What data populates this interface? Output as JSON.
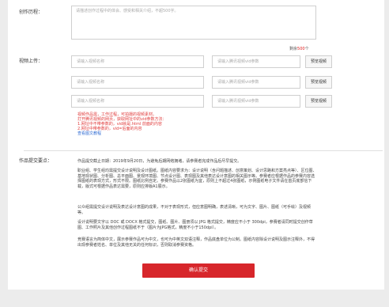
{
  "form": {
    "creation_label": "创作历程：",
    "creation_placeholder": "请描述创作过程中的体会、感受和相关介绍，不超500字。",
    "counter_prefix": "剩余",
    "counter_value": "500",
    "counter_suffix": "个",
    "video_label": "视频上传：",
    "video_rows": [
      {
        "name_placeholder": "请输入视频名称",
        "vid_placeholder": "请输入腾讯视频vid参数",
        "preview": "预览视频"
      },
      {
        "name_placeholder": "请输入视频名称",
        "vid_placeholder": "请输入腾讯视频vid参数",
        "preview": "预览视频"
      },
      {
        "name_placeholder": "请输入视频名称",
        "vid_placeholder": "请输入腾讯视频vid参数",
        "preview": "预览视频"
      }
    ],
    "notes": [
      "视频作品需，工作过程，可拍摄的视频素材。",
      "打开腾讯视频的网页，获取网址中的vid参数方法：",
      "1.网址中不带参数的，vid就是.html 前面的内容",
      "2.网址中带参数的，vid=后面的内容"
    ],
    "notes_link": "查看图文教程",
    "submit_rules_label": "作品提交要点：",
    "rules": [
      "作品提交截止日期：2019年9月20日，为避免后期网络拥堵，请参赛者完成作品后尽早提交。",
      "职业组、学生组均需提交设计说明及设计图纸。图纸内容要求为：设计说明（含问题描述、创意策划、设计思路和方案亮点等）、区位图、基地现状图、分析图、总平面图、景观环境图、节点设计图、表现图及其他表达设计意图的相关图示等。参赛者应根据作品的参赛内容选择图纸的表现方式，形式不限。图纸比例自定。参赛作品以2张图纸为宜，原则上不超过4张图纸，示例图纸电子文件请在首页底部信下载，版式可根据作品表达需要，原则应排版A1展示。",
      "公众组需提交设计说明及表达设计意图的成果，不对于表现形式，但应意图明确，表述清晰，可为文字、图片、图纸（可手绘）及视频等。",
      "设计说明要文字以 DOC 或 DOCX 格式提交，图纸、图片、图册须以 JPG 格式提交，精度应不小于 300dpi，参赛者请同时提交创作草图、工作照片及其他创作过程图纸不于（图片为JPG格式，精度不小于150dpi）。",
      "竞赛语言为简体中文，展示参赛作品可为中文，也可为中英文双语注释，作品底盘单位为公制。图纸内容除设计说明及图示注释外，不得出现参赛者姓名、单位及其他无关的任何标识，否则取消参赛资格。"
    ],
    "submit_button": "确认提交"
  }
}
